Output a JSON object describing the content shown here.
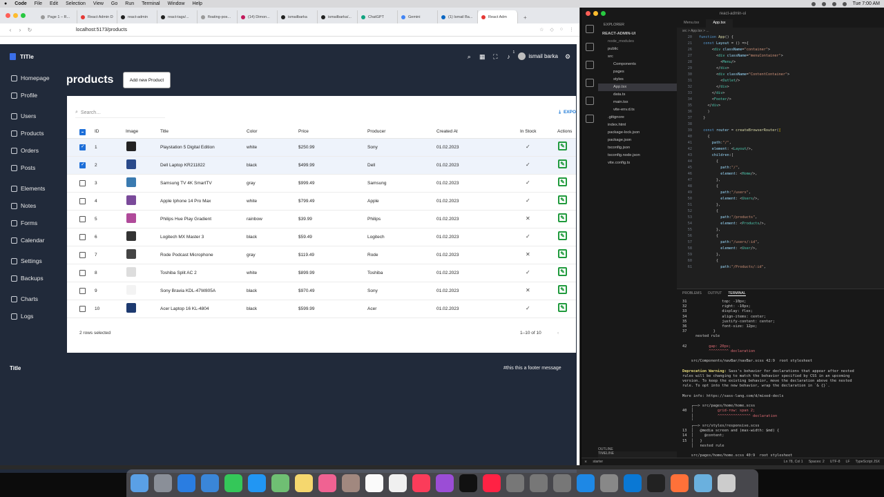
{
  "menubar": {
    "items": [
      "Code",
      "File",
      "Edit",
      "Selection",
      "View",
      "Go",
      "Run",
      "Terminal",
      "Window",
      "Help"
    ],
    "time": "Tue 7:00 AM"
  },
  "browser": {
    "tabs": [
      "Page 1 – R...",
      "React Admin D",
      "react-admin",
      "react-tags/...",
      "floating-pos...",
      "(14) Dimon...",
      "ismailbarka",
      "ismailbarka/...",
      "ChatGPT",
      "Gemini",
      "(1) Ismail Ba...",
      "React Adm"
    ],
    "url": "localhost:5173/products"
  },
  "app": {
    "logo": "TITle",
    "user": "ismail barka",
    "notif_count": "1",
    "sidebar": [
      "Homepage",
      "Profile",
      "Users",
      "Products",
      "Orders",
      "Posts",
      "Elements",
      "Notes",
      "Forms",
      "Calendar",
      "Settings",
      "Backups",
      "Charts",
      "Logs"
    ],
    "page_title": "products",
    "add_button": "Add new Product",
    "search_placeholder": "Search…",
    "export_label": "EXPO",
    "columns": [
      "ID",
      "Image",
      "Title",
      "Color",
      "Price",
      "Producer",
      "Created At",
      "In Stock",
      "Actions"
    ],
    "rows": [
      {
        "selected": true,
        "id": "1",
        "title": "Playstation 5 Digital Edition",
        "color": "white",
        "price": "$250.99",
        "producer": "Sony",
        "created": "01.02.2023",
        "stock": true,
        "thumb": "#222"
      },
      {
        "selected": true,
        "id": "2",
        "title": "Dell Laptop KR211822",
        "color": "black",
        "price": "$499.99",
        "producer": "Dell",
        "created": "01.02.2023",
        "stock": true,
        "thumb": "#2a4a8a"
      },
      {
        "selected": false,
        "id": "3",
        "title": "Samsung TV 4K SmartTV",
        "color": "gray",
        "price": "$999.49",
        "producer": "Samsung",
        "created": "01.02.2023",
        "stock": true,
        "thumb": "#3a7ab0"
      },
      {
        "selected": false,
        "id": "4",
        "title": "Apple Iphone 14 Pro Max",
        "color": "white",
        "price": "$799.49",
        "producer": "Apple",
        "created": "01.02.2023",
        "stock": true,
        "thumb": "#7a4a9a"
      },
      {
        "selected": false,
        "id": "5",
        "title": "Philips Hue Play Gradient",
        "color": "rainbow",
        "price": "$39.99",
        "producer": "Philips",
        "created": "01.02.2023",
        "stock": false,
        "thumb": "#b04a9a"
      },
      {
        "selected": false,
        "id": "6",
        "title": "Logitech MX Master 3",
        "color": "black",
        "price": "$59.49",
        "producer": "Logitech",
        "created": "01.02.2023",
        "stock": true,
        "thumb": "#333"
      },
      {
        "selected": false,
        "id": "7",
        "title": "Rode Podcast Microphone",
        "color": "gray",
        "price": "$119.49",
        "producer": "Rode",
        "created": "01.02.2023",
        "stock": false,
        "thumb": "#444"
      },
      {
        "selected": false,
        "id": "8",
        "title": "Toshiba Split AC 2",
        "color": "white",
        "price": "$899.99",
        "producer": "Toshiba",
        "created": "01.02.2023",
        "stock": true,
        "thumb": "#ddd"
      },
      {
        "selected": false,
        "id": "9",
        "title": "Sony Bravia KDL-47W805A",
        "color": "black",
        "price": "$970.49",
        "producer": "Sony",
        "created": "01.02.2023",
        "stock": false,
        "thumb": "#f3f3f3"
      },
      {
        "selected": false,
        "id": "10",
        "title": "Acer Laptop 16 KL-4804",
        "color": "black",
        "price": "$599.99",
        "producer": "Acer",
        "created": "01.02.2023",
        "stock": true,
        "thumb": "#1d3a70"
      }
    ],
    "selected_text": "2 rows selected",
    "pagination": "1–10 of 10",
    "footer_left": "Title",
    "footer_right": "#this this a footer message"
  },
  "vscode": {
    "title": "react-admin-ui",
    "explorer_header": "EXPLORER",
    "project": "REACT-ADMIN-UI",
    "tree": [
      "node_modules",
      "public",
      "src",
      "Components",
      "pages",
      "styles",
      "App.tsx",
      "data.ts",
      "main.tsx",
      "vite-env.d.ts",
      ".gitignore",
      "index.html",
      "package-lock.json",
      "package.json",
      "tsconfig.json",
      "tsconfig.node.json",
      "vite.config.ts"
    ],
    "tabs": [
      "Menu.tsx",
      "App.tsx"
    ],
    "breadcrumb": "src > App.tsx > ...",
    "panel_tabs": [
      "PROBLEMS",
      "OUTPUT",
      "TERMINAL"
    ],
    "outline": [
      "OUTLINE",
      "TIMELINE"
    ],
    "status_left": "starter",
    "status_right": [
      "Ln 78, Col 1",
      "Spaces: 2",
      "UTF-8",
      "LF",
      "TypeScript JSX"
    ]
  }
}
